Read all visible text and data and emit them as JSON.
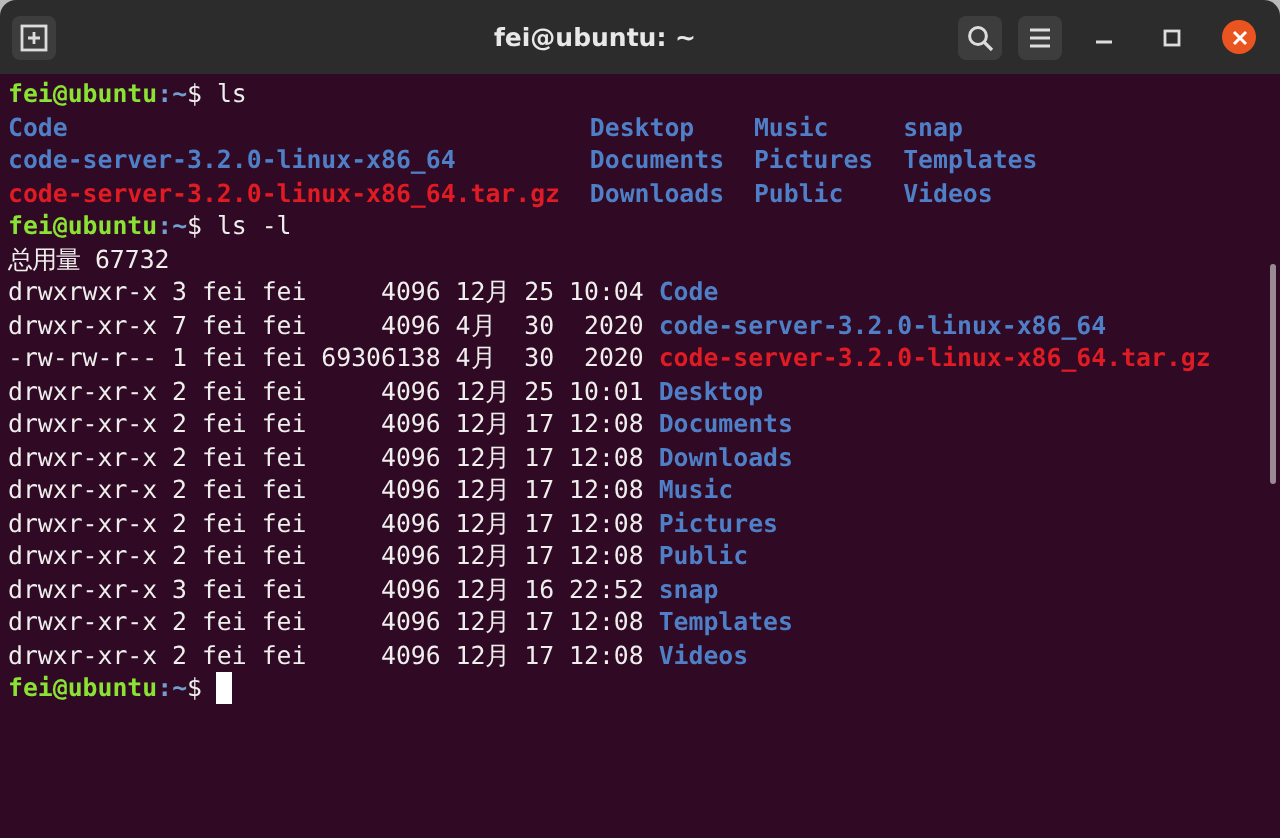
{
  "window": {
    "title": "fei@ubuntu: ~"
  },
  "terminal": [
    {
      "kind": "prompt",
      "user": "fei@ubuntu",
      "path": ":~",
      "symbol": "$",
      "command": "ls"
    },
    {
      "kind": "grid",
      "rows": [
        [
          {
            "text": "Code",
            "kind": "dir"
          },
          {
            "text": "Desktop",
            "kind": "dir"
          },
          {
            "text": "Music",
            "kind": "dir"
          },
          {
            "text": "snap",
            "kind": "dir"
          }
        ],
        [
          {
            "text": "code-server-3.2.0-linux-x86_64",
            "kind": "dir"
          },
          {
            "text": "Documents",
            "kind": "dir"
          },
          {
            "text": "Pictures",
            "kind": "dir"
          },
          {
            "text": "Templates",
            "kind": "dir"
          }
        ],
        [
          {
            "text": "code-server-3.2.0-linux-x86_64.tar.gz",
            "kind": "archive"
          },
          {
            "text": "Downloads",
            "kind": "dir"
          },
          {
            "text": "Public",
            "kind": "dir"
          },
          {
            "text": "Videos",
            "kind": "dir"
          }
        ]
      ]
    },
    {
      "kind": "prompt",
      "user": "fei@ubuntu",
      "path": ":~",
      "symbol": "$",
      "command": "ls -l"
    },
    {
      "kind": "text",
      "text": "总用量 67732"
    },
    {
      "kind": "entry",
      "info": "drwxrwxr-x 3 fei fei     4096 12月 25 10:04",
      "name": {
        "text": "Code",
        "kind": "dir"
      }
    },
    {
      "kind": "entry",
      "info": "drwxr-xr-x 7 fei fei     4096 4月  30  2020",
      "name": {
        "text": "code-server-3.2.0-linux-x86_64",
        "kind": "dir"
      }
    },
    {
      "kind": "entry",
      "info": "-rw-rw-r-- 1 fei fei 69306138 4月  30  2020",
      "name": {
        "text": "code-server-3.2.0-linux-x86_64.tar.gz",
        "kind": "archive"
      }
    },
    {
      "kind": "entry",
      "info": "drwxr-xr-x 2 fei fei     4096 12月 25 10:01",
      "name": {
        "text": "Desktop",
        "kind": "dir"
      }
    },
    {
      "kind": "entry",
      "info": "drwxr-xr-x 2 fei fei     4096 12月 17 12:08",
      "name": {
        "text": "Documents",
        "kind": "dir"
      }
    },
    {
      "kind": "entry",
      "info": "drwxr-xr-x 2 fei fei     4096 12月 17 12:08",
      "name": {
        "text": "Downloads",
        "kind": "dir"
      }
    },
    {
      "kind": "entry",
      "info": "drwxr-xr-x 2 fei fei     4096 12月 17 12:08",
      "name": {
        "text": "Music",
        "kind": "dir"
      }
    },
    {
      "kind": "entry",
      "info": "drwxr-xr-x 2 fei fei     4096 12月 17 12:08",
      "name": {
        "text": "Pictures",
        "kind": "dir"
      }
    },
    {
      "kind": "entry",
      "info": "drwxr-xr-x 2 fei fei     4096 12月 17 12:08",
      "name": {
        "text": "Public",
        "kind": "dir"
      }
    },
    {
      "kind": "entry",
      "info": "drwxr-xr-x 3 fei fei     4096 12月 16 22:52",
      "name": {
        "text": "snap",
        "kind": "dir"
      }
    },
    {
      "kind": "entry",
      "info": "drwxr-xr-x 2 fei fei     4096 12月 17 12:08",
      "name": {
        "text": "Templates",
        "kind": "dir"
      }
    },
    {
      "kind": "entry",
      "info": "drwxr-xr-x 2 fei fei     4096 12月 17 12:08",
      "name": {
        "text": "Videos",
        "kind": "dir"
      }
    },
    {
      "kind": "prompt",
      "user": "fei@ubuntu",
      "path": ":~",
      "symbol": "$",
      "cursor": true
    }
  ]
}
